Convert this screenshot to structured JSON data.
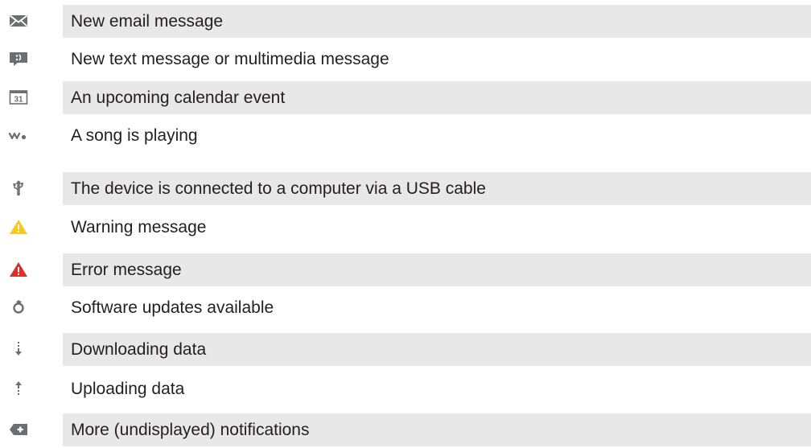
{
  "notifications": {
    "items": [
      {
        "icon": "email-envelope-icon",
        "label": "New email message"
      },
      {
        "icon": "text-message-bubble-icon",
        "label": "New text message or multimedia message"
      },
      {
        "icon": "calendar-31-icon",
        "label": "An upcoming calendar event"
      },
      {
        "icon": "walkman-music-icon",
        "label": "A song is playing"
      },
      {
        "icon": "usb-icon",
        "label": "The device is connected to a computer via a USB cable"
      },
      {
        "icon": "warning-triangle-icon",
        "label": "Warning message"
      },
      {
        "icon": "error-triangle-icon",
        "label": "Error message"
      },
      {
        "icon": "software-update-icon",
        "label": "Software updates available"
      },
      {
        "icon": "download-arrow-icon",
        "label": "Downloading data"
      },
      {
        "icon": "upload-arrow-icon",
        "label": "Uploading data"
      },
      {
        "icon": "more-notifications-icon",
        "label": "More (undisplayed) notifications"
      }
    ]
  },
  "colors": {
    "row_shade": "#e8e8e9",
    "text": "#231f20",
    "icon_gray": "#6d6e71",
    "warning_yellow": "#f7c81e",
    "error_red": "#d9302a"
  }
}
